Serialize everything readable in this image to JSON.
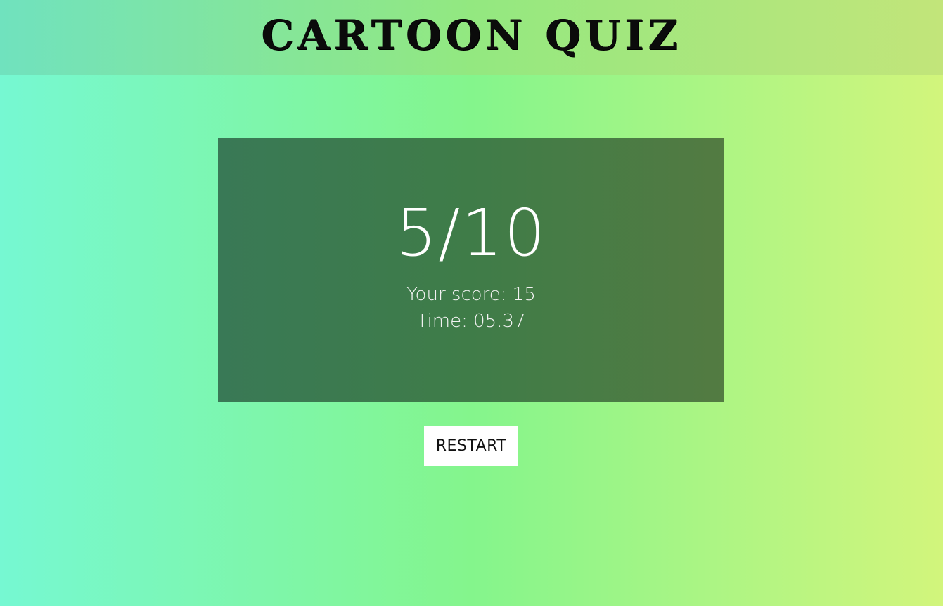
{
  "header": {
    "title": "Cartoon Quiz"
  },
  "result": {
    "ratio": "5/10",
    "score_text": "Your score: 15",
    "time_text": "Time: 05.37"
  },
  "actions": {
    "restart_label": "Restart"
  },
  "colors": {
    "background_left": "#76f8d2",
    "background_mid": "#84f58c",
    "background_right": "#d2f57c",
    "card": "#3f7c48",
    "button": "#ffffff"
  }
}
